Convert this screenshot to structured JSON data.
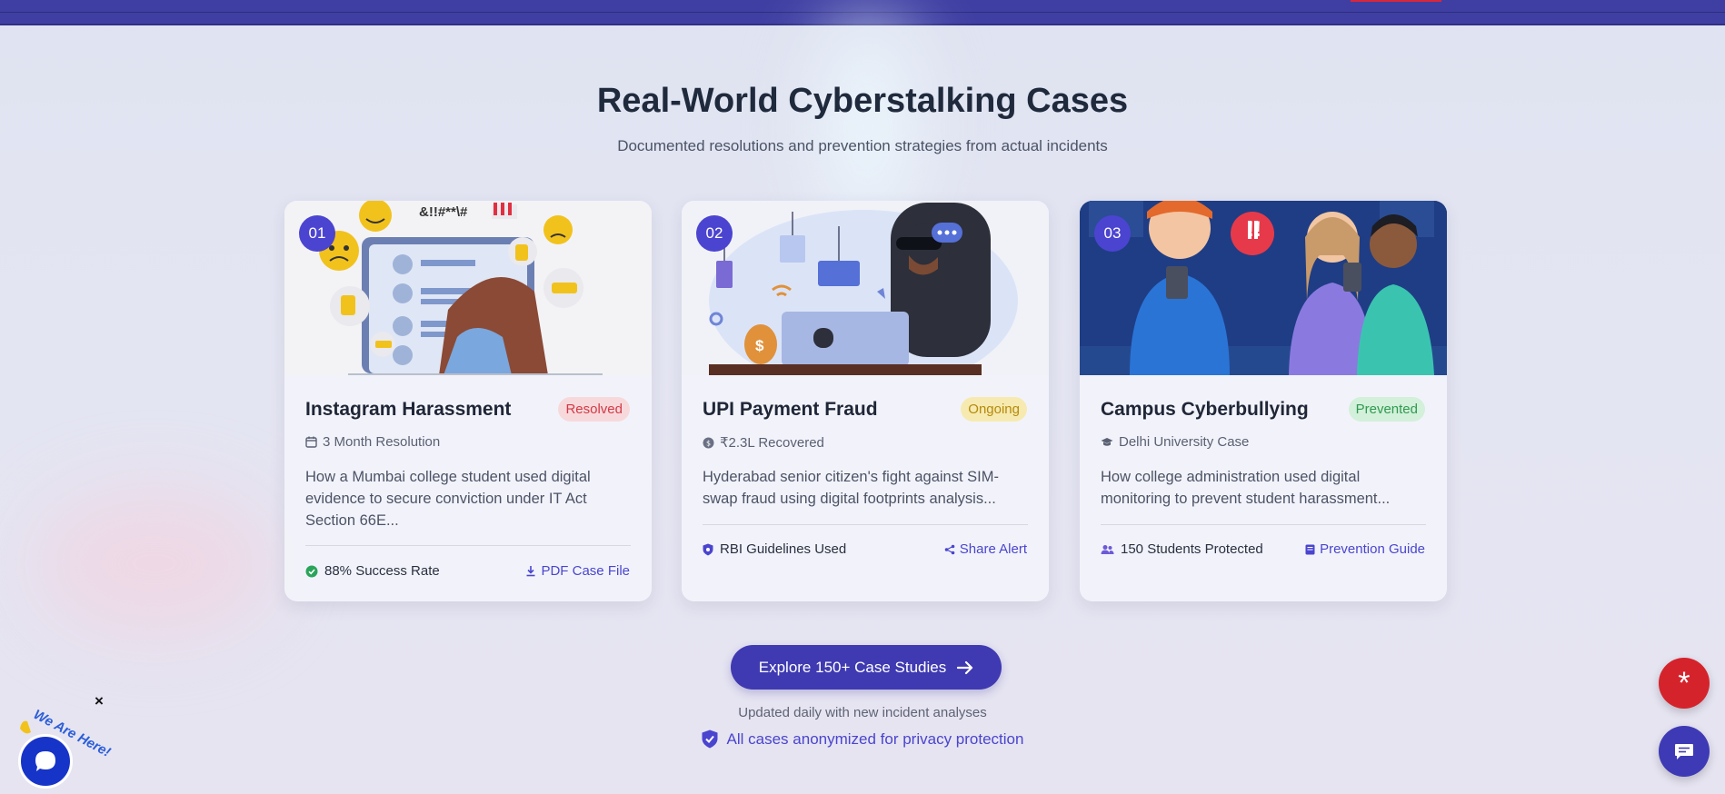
{
  "header": {
    "title": "Real-World Cyberstalking Cases",
    "subtitle": "Documented resolutions and prevention strategies from actual incidents"
  },
  "cards": [
    {
      "number": "01",
      "title": "Instagram Harassment",
      "badge": "Resolved",
      "meta_icon": "calendar-icon",
      "meta": "3 Month Resolution",
      "description": "How a Mumbai college student used digital evidence to secure conviction under IT Act Section 66E...",
      "footer_left_icon": "check-circle-icon",
      "footer_left": "88% Success Rate",
      "footer_right_icon": "download-icon",
      "footer_right": "PDF Case File",
      "image_text": "&!!#**\\#"
    },
    {
      "number": "02",
      "title": "UPI Payment Fraud",
      "badge": "Ongoing",
      "meta_icon": "money-icon",
      "meta": "₹2.3L Recovered",
      "description": "Hyderabad senior citizen's fight against SIM-swap fraud using digital footprints analysis...",
      "footer_left_icon": "shield-icon",
      "footer_left": "RBI Guidelines Used",
      "footer_right_icon": "share-icon",
      "footer_right": "Share Alert",
      "image_text": "$"
    },
    {
      "number": "03",
      "title": "Campus Cyberbullying",
      "badge": "Prevented",
      "meta_icon": "graduation-cap-icon",
      "meta": "Delhi University Case",
      "description": "How college administration used digital monitoring to prevent student harassment...",
      "footer_left_icon": "users-icon",
      "footer_left": "150 Students Protected",
      "footer_right_icon": "book-icon",
      "footer_right": "Prevention Guide",
      "image_text": "!!"
    }
  ],
  "cta": {
    "label": "Explore 150+ Case Studies"
  },
  "footer": {
    "updated": "Updated daily with new incident analyses",
    "privacy": "All cases anonymized for privacy protection"
  },
  "widget": {
    "label": "We Are Here!",
    "close": "×"
  },
  "fab": {
    "help_symbol": "*"
  },
  "colors": {
    "primary": "#3f3ab2",
    "resolved_bg": "#f7d9dc",
    "resolved_fg": "#d23a45",
    "ongoing_bg": "#f6eab1",
    "ongoing_fg": "#b58a0b",
    "prevented_bg": "#d3f0da",
    "prevented_fg": "#2f9a50"
  }
}
